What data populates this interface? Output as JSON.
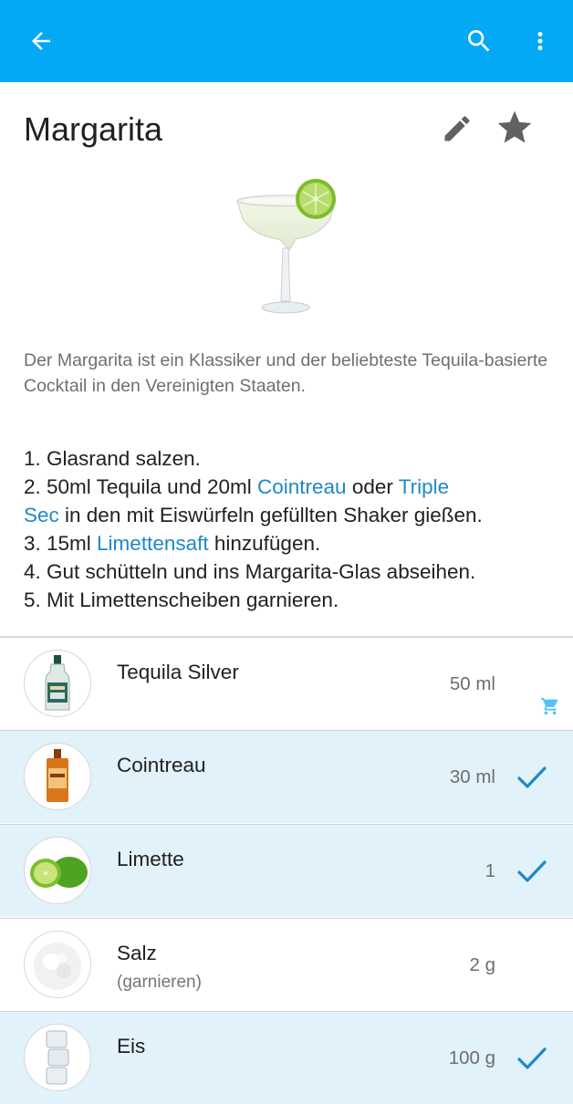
{
  "app_bar": {
    "color": "#03a9f4"
  },
  "drink": {
    "title": "Margarita",
    "description": "Der Margarita ist ein Klassiker und der beliebteste Tequila-basierte Cocktail in den Vereinigten Staaten."
  },
  "steps": {
    "s1": "1. Glasrand salzen.",
    "s2a": "2. 50ml Tequila und 20ml ",
    "s2_link1": "Cointreau",
    "s2b": " oder ",
    "s2_link2a": "Triple",
    "s2_link2b": "Sec",
    "s2c": " in den mit Eiswürfeln gefüllten Shaker gießen.",
    "s3a": "3. 15ml ",
    "s3_link": "Limettensaft",
    "s3b": " hinzufügen.",
    "s4": "4. Gut schütteln und ins Margarita-Glas abseihen.",
    "s5": "5. Mit Limettenscheiben garnieren."
  },
  "ingredients": [
    {
      "name": "Tequila Silver",
      "amount": "50 ml",
      "in_stock": false,
      "icon": "cart-icon"
    },
    {
      "name": "Cointreau",
      "amount": "30 ml",
      "in_stock": true,
      "icon": "check-icon"
    },
    {
      "name": "Limette",
      "amount": "1",
      "in_stock": true,
      "icon": "check-icon"
    },
    {
      "name": "Salz",
      "note": "(garnieren)",
      "amount": "2 g",
      "in_stock": false
    },
    {
      "name": "Eis",
      "amount": "100 g",
      "in_stock": true,
      "icon": "check-icon"
    }
  ],
  "colors": {
    "accent": "#03a9f4",
    "link": "#1e88c8",
    "in_stock_row": "#e1f2fb",
    "check": "#1e88c8"
  }
}
